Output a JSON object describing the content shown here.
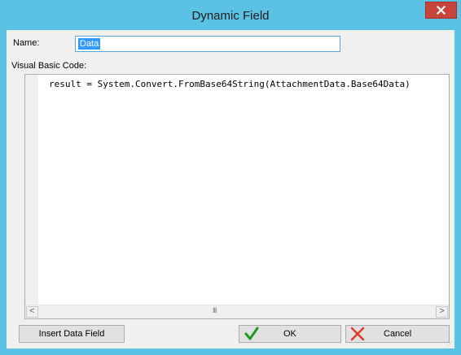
{
  "window": {
    "title": "Dynamic Field",
    "close_glyph": "x",
    "titlebar_color": "#5bc2e6",
    "close_color": "#c7453a"
  },
  "form": {
    "name_label": "Name:",
    "name_value": "Data",
    "code_label": "Visual Basic Code:",
    "code": "result = System.Convert.FromBase64String(AttachmentData.Base64Data)"
  },
  "scrollbar": {
    "left_arrow": "<",
    "right_arrow": ">",
    "thumb_grip": "III"
  },
  "buttons": {
    "insert_label": "Insert Data Field",
    "ok_label": "OK",
    "cancel_label": "Cancel"
  },
  "icons": {
    "ok": "checkmark-icon",
    "cancel": "x-icon",
    "close": "close-icon"
  }
}
